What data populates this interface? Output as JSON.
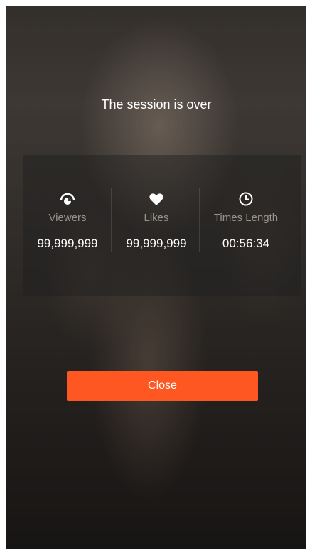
{
  "session": {
    "title": "The session is over"
  },
  "stats": [
    {
      "icon": "eye-icon",
      "label": "Viewers",
      "value": "99,999,999"
    },
    {
      "icon": "heart-icon",
      "label": "Likes",
      "value": "99,999,999"
    },
    {
      "icon": "clock-icon",
      "label": "Times Length",
      "value": "00:56:34"
    }
  ],
  "actions": {
    "close_label": "Close"
  },
  "colors": {
    "accent": "#ff5722",
    "label": "#9a938d",
    "text": "#ffffff"
  }
}
